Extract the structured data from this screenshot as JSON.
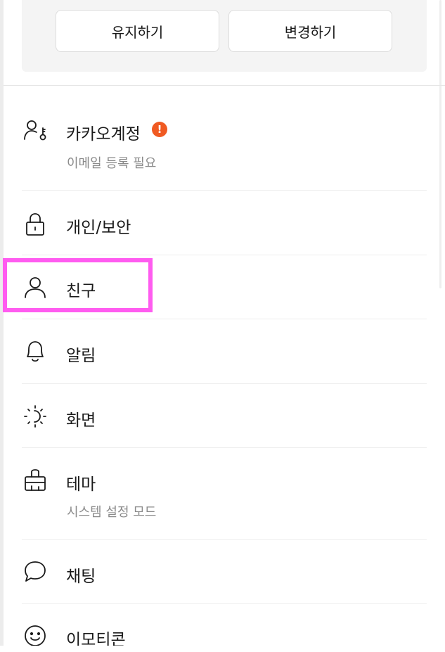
{
  "top_card": {
    "keep_label": "유지하기",
    "change_label": "변경하기"
  },
  "menu": [
    {
      "id": "kakao-account",
      "label": "카카오계정",
      "sub": "이메일 등록 필요",
      "icon": "account-key-icon",
      "badge": "!"
    },
    {
      "id": "privacy-security",
      "label": "개인/보안",
      "icon": "lock-icon"
    },
    {
      "id": "friends",
      "label": "친구",
      "icon": "person-icon"
    },
    {
      "id": "notifications",
      "label": "알림",
      "icon": "bell-icon"
    },
    {
      "id": "display",
      "label": "화면",
      "icon": "brightness-icon"
    },
    {
      "id": "theme",
      "label": "테마",
      "sub": "시스템 설정 모드",
      "icon": "brush-icon"
    },
    {
      "id": "chat",
      "label": "채팅",
      "icon": "chat-bubble-icon"
    },
    {
      "id": "emoticon",
      "label": "이모티콘",
      "icon": "smiley-icon"
    }
  ],
  "colors": {
    "alert_badge": "#f05a22",
    "highlight": "#ff5cf0",
    "card_background": "#f4f4f4"
  }
}
